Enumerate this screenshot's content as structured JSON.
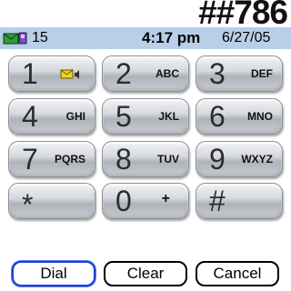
{
  "dialed_number": "##786",
  "status": {
    "message_count": "15",
    "time": "4:17 pm",
    "date": "6/27/05"
  },
  "keypad": {
    "k1": {
      "digit": "1",
      "letters": ""
    },
    "k2": {
      "digit": "2",
      "letters": "ABC"
    },
    "k3": {
      "digit": "3",
      "letters": "DEF"
    },
    "k4": {
      "digit": "4",
      "letters": "GHI"
    },
    "k5": {
      "digit": "5",
      "letters": "JKL"
    },
    "k6": {
      "digit": "6",
      "letters": "MNO"
    },
    "k7": {
      "digit": "7",
      "letters": "PQRS"
    },
    "k8": {
      "digit": "8",
      "letters": "TUV"
    },
    "k9": {
      "digit": "9",
      "letters": "WXYZ"
    },
    "kstar": {
      "digit": "*",
      "letters": ""
    },
    "k0": {
      "digit": "0",
      "letters": "+"
    },
    "khash": {
      "digit": "#",
      "letters": ""
    }
  },
  "actions": {
    "dial": "Dial",
    "clear": "Clear",
    "cancel": "Cancel"
  },
  "colors": {
    "statusbar": "#b9cee9",
    "dial_focus": "#1b3fd6"
  },
  "icons": {
    "status": "envelope-phone-icon",
    "voicemail": "voicemail-envelope-icon"
  }
}
